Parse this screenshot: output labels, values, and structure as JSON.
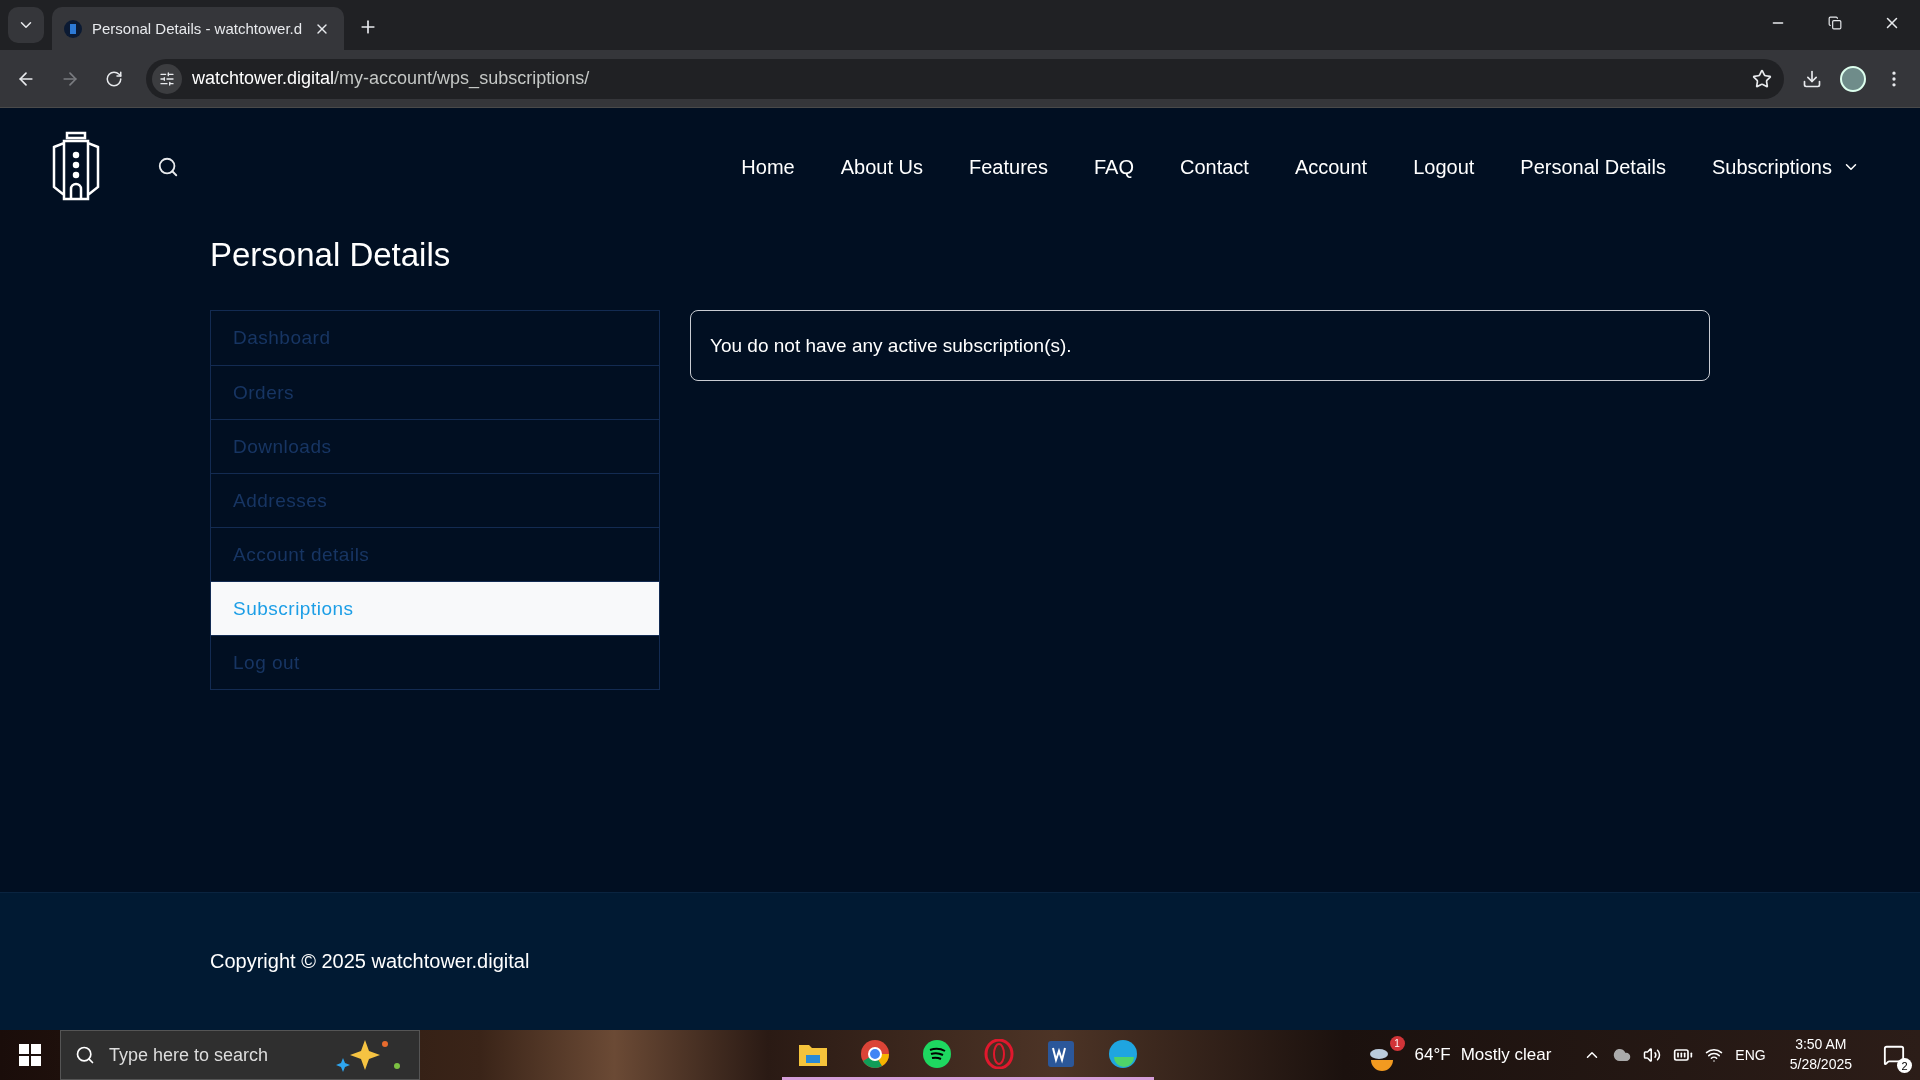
{
  "browser": {
    "tab_title": "Personal Details - watchtower.d",
    "url_domain": "watchtower.digital",
    "url_path": "/my-account/wps_subscriptions/"
  },
  "nav": [
    {
      "label": "Home",
      "kind": "link"
    },
    {
      "label": "About Us",
      "kind": "link"
    },
    {
      "label": "Features",
      "kind": "link"
    },
    {
      "label": "FAQ",
      "kind": "link"
    },
    {
      "label": "Contact",
      "kind": "link"
    },
    {
      "label": "Account",
      "kind": "link"
    },
    {
      "label": "Logout",
      "kind": "link"
    },
    {
      "label": "Personal Details",
      "kind": "link"
    },
    {
      "label": "Subscriptions",
      "kind": "dropdown"
    }
  ],
  "page_title": "Personal Details",
  "account_menu": [
    {
      "label": "Dashboard",
      "selected": false
    },
    {
      "label": "Orders",
      "selected": false
    },
    {
      "label": "Downloads",
      "selected": false
    },
    {
      "label": "Addresses",
      "selected": false
    },
    {
      "label": "Account details",
      "selected": false
    },
    {
      "label": "Subscriptions",
      "selected": true
    },
    {
      "label": "Log out",
      "selected": false
    }
  ],
  "notice": "You do not have any active subscription(s).",
  "footer": {
    "copyright": "Copyright © 2025 watchtower.digital"
  },
  "taskbar": {
    "search_placeholder": "Type here to search",
    "weather_badge": "1",
    "temperature": "64°F",
    "condition": "Mostly clear",
    "language": "ENG",
    "time": "3:50 AM",
    "date": "5/28/2025",
    "notification_count": "2"
  }
}
